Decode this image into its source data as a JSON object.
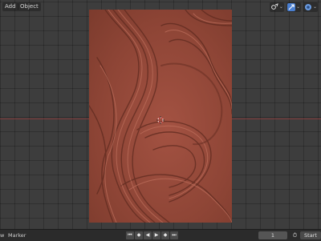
{
  "header": {
    "menus": [
      {
        "label": "Add"
      },
      {
        "label": "Object"
      }
    ],
    "icons": [
      {
        "name": "transform-pivot-icon",
        "color": "#e3e3e3"
      },
      {
        "name": "gizmo-icon",
        "color": "#4a7fd1"
      },
      {
        "name": "overlay-icon",
        "color": "#6a9be0"
      }
    ]
  },
  "viewport": {
    "background": "#3d3d3d",
    "x_axis_color": "#8a3c3c",
    "sculpt_color": "#8e4536"
  },
  "timeline": {
    "view_label": "w",
    "marker_label": "Marker",
    "playback_buttons": [
      "jump-start",
      "prev-keyframe",
      "play-reverse",
      "play",
      "next-keyframe",
      "jump-end"
    ],
    "current_frame": "1",
    "clock_glyph": "⏱",
    "start_label": "Start"
  }
}
